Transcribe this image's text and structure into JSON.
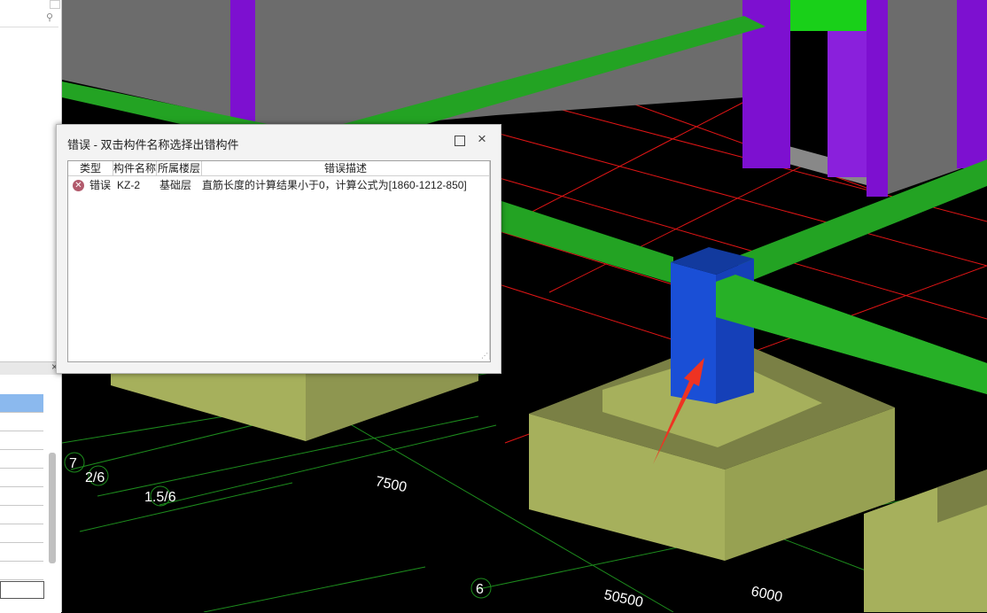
{
  "dialog": {
    "title": "错误 - 双击构件名称选择出错构件",
    "maximize_icon": "square-icon",
    "close_icon": "×",
    "columns": [
      "类型",
      "构件名称",
      "所属楼层",
      "错误描述"
    ],
    "rows": [
      {
        "type": "错误",
        "name": "KZ-2",
        "floor": "基础层",
        "description": "直筋长度的计算结果小于0，计算公式为[1860-1212-850]"
      }
    ]
  },
  "viewport": {
    "axis_labels": [
      "7",
      "2/6",
      "1.5/6",
      "6"
    ],
    "dimensions": [
      "7500",
      "50500",
      "6000"
    ],
    "colors": {
      "background": "#000000",
      "beam": "#23a323",
      "column_purple": "#7d10d0",
      "wall": "#6c6c6c",
      "footing": "#a6b05c",
      "selected_column": "#1a4fd6",
      "grid_red": "#e11515",
      "grid_green": "#1d8c1d",
      "arrow": "#ee3322"
    }
  },
  "left_panel": {
    "search_icon": "⚲",
    "close_icon": "×"
  }
}
